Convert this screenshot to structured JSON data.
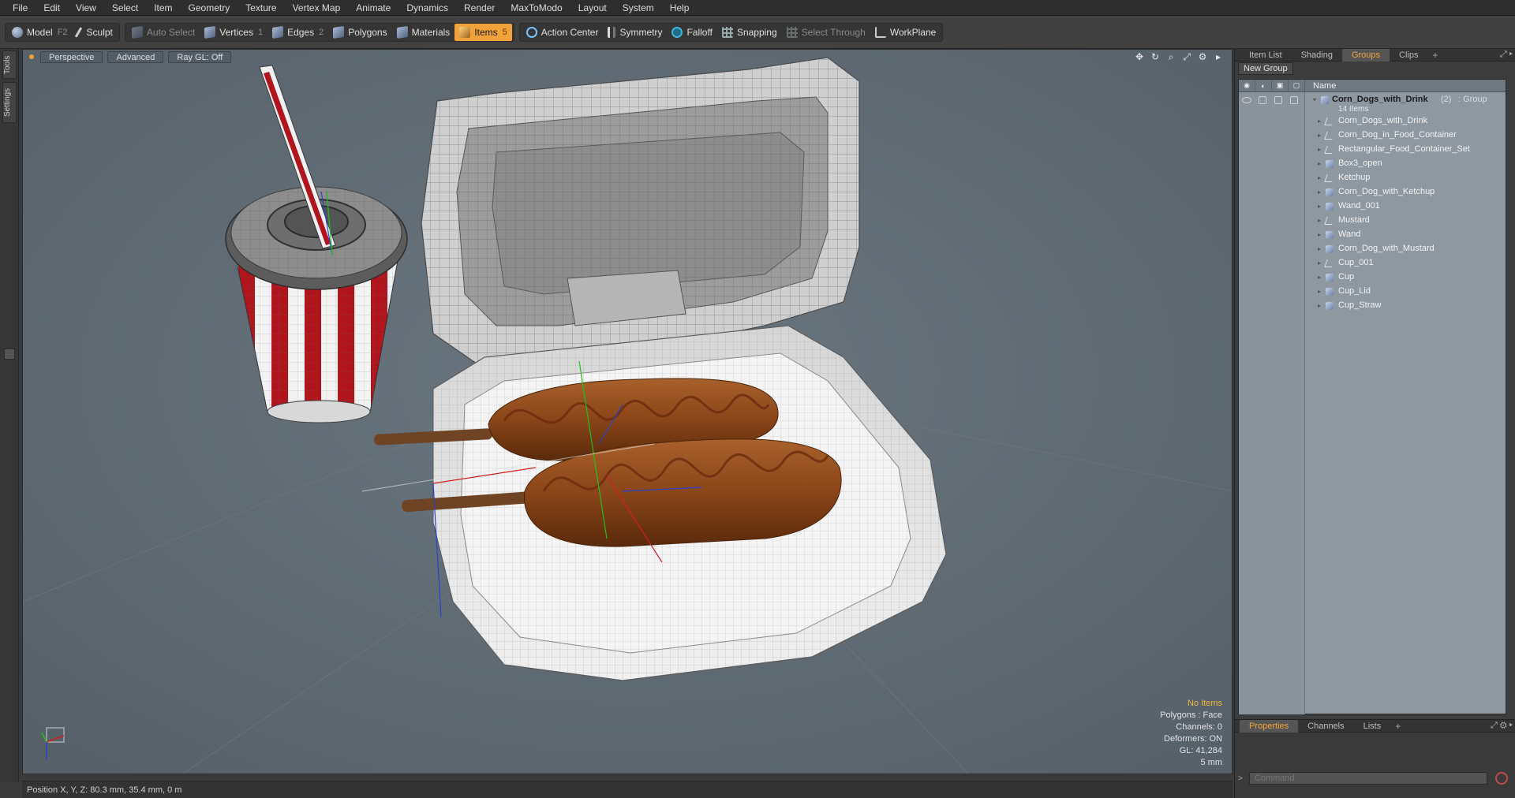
{
  "menu": [
    "File",
    "Edit",
    "View",
    "Select",
    "Item",
    "Geometry",
    "Texture",
    "Vertex Map",
    "Animate",
    "Dynamics",
    "Render",
    "MaxToModo",
    "Layout",
    "System",
    "Help"
  ],
  "toolbar": {
    "model": "Model",
    "model_key": "F2",
    "sculpt": "Sculpt",
    "auto_select": "Auto Select",
    "vertices": "Vertices",
    "vertices_key": "1",
    "edges": "Edges",
    "edges_key": "2",
    "polygons": "Polygons",
    "materials": "Materials",
    "items": "Items",
    "items_key": "5",
    "action_center": "Action Center",
    "symmetry": "Symmetry",
    "falloff": "Falloff",
    "snapping": "Snapping",
    "select_through": "Select Through",
    "workplane": "WorkPlane"
  },
  "left_strip": {
    "tools": "Tools",
    "settings": "Settings"
  },
  "viewport": {
    "view_mode": "Perspective",
    "shading": "Advanced",
    "raygl": "Ray GL: Off",
    "stats": {
      "no_items": "No Items",
      "polygons": "Polygons : Face",
      "channels": "Channels: 0",
      "deformers": "Deformers: ON",
      "gl": "GL: 41,284",
      "unit": "5 mm"
    }
  },
  "status": {
    "position": "Position X, Y, Z:   80.3 mm, 35.4 mm, 0 m"
  },
  "right_panel": {
    "tabs": [
      "Item List",
      "Shading",
      "Groups",
      "Clips"
    ],
    "active_tab": "Groups",
    "new_group": "New Group",
    "name_header": "Name",
    "group": {
      "name": "Corn_Dogs_with_Drink",
      "count": "(2)",
      "type": ": Group",
      "items_count": "14 Items"
    },
    "items": [
      {
        "label": "Corn_Dogs_with_Drink",
        "icon": "locator-icon"
      },
      {
        "label": "Corn_Dog_in_Food_Container",
        "icon": "locator-icon"
      },
      {
        "label": "Rectangular_Food_Container_Set",
        "icon": "locator-icon"
      },
      {
        "label": "Box3_open",
        "icon": "mesh-icon"
      },
      {
        "label": "Ketchup",
        "icon": "locator-icon"
      },
      {
        "label": "Corn_Dog_with_Ketchup",
        "icon": "mesh-icon"
      },
      {
        "label": "Wand_001",
        "icon": "mesh-icon"
      },
      {
        "label": "Mustard",
        "icon": "locator-icon"
      },
      {
        "label": "Wand",
        "icon": "mesh-icon"
      },
      {
        "label": "Corn_Dog_with_Mustard",
        "icon": "mesh-icon"
      },
      {
        "label": "Cup_001",
        "icon": "locator-icon"
      },
      {
        "label": "Cup",
        "icon": "mesh-icon"
      },
      {
        "label": "Cup_Lid",
        "icon": "mesh-icon"
      },
      {
        "label": "Cup_Straw",
        "icon": "mesh-icon"
      }
    ],
    "bottom_tabs": [
      "Properties",
      "Channels",
      "Lists"
    ],
    "bottom_active": "Properties",
    "command_placeholder": "Command"
  },
  "colors": {
    "accent": "#f2a23a",
    "viewport_bg": "#5f6b74",
    "tree_bg": "#8e98a0"
  }
}
